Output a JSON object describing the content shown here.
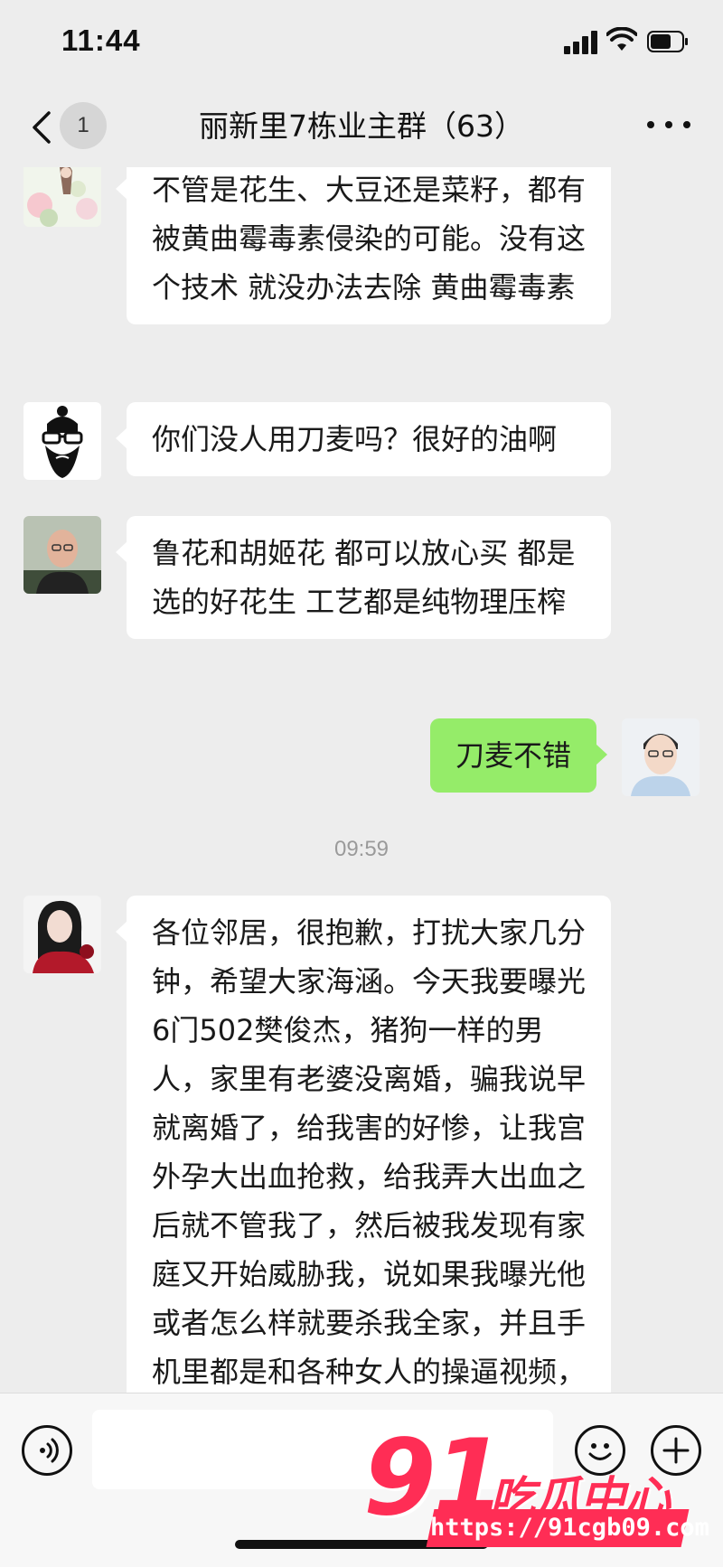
{
  "status_bar": {
    "time": "11:44"
  },
  "header": {
    "unread_badge": "1",
    "title": "丽新里7栋业主群（63）"
  },
  "messages": [
    {
      "text": "不管是花生、大豆还是菜籽，都有被黄曲霉毒素侵染的可能。没有这个技术 就没办法去除 黄曲霉毒素"
    },
    {
      "text": "你们没人用刀麦吗？很好的油啊"
    },
    {
      "text": "鲁花和胡姬花 都可以放心买 都是选的好花生 工艺都是纯物理压榨"
    },
    {
      "text": "刀麦不错"
    },
    {
      "text": "各位邻居，很抱歉，打扰大家几分钟，希望大家海涵。今天我要曝光6门502樊俊杰，猪狗一样的男人，家里有老婆没离婚，骗我说早就离婚了，给我害的好惨，让我宫外孕大出血抢救，给我弄大出血之后就不管我了，然后被我发现有家庭又开始威胁我，说如果我曝光他或者怎么样就要杀我全家，并且手机里都是和各种女人的操逼视频，我不相"
    }
  ],
  "timestamp": "09:59",
  "watermark": {
    "number": "91",
    "text": "吃瓜中心",
    "url": "https://91cgb09.com"
  },
  "colors": {
    "background": "#ededed",
    "bubble_self": "#95ec69",
    "bubble_other": "#ffffff",
    "watermark": "#ff2d55"
  }
}
